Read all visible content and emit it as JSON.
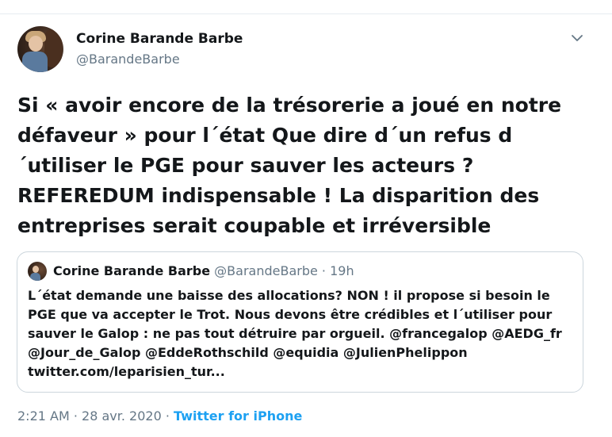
{
  "author": {
    "name": "Corine Barande Barbe",
    "handle": "@BarandeBarbe"
  },
  "tweet": {
    "text": "Si « avoir encore de la trésorerie a joué en notre défaveur » pour l´état Que dire d´un refus d´utiliser le PGE pour sauver les acteurs ? REFEREDUM indispensable ! La disparition des entreprises serait coupable et irréversible"
  },
  "quoted_tweet": {
    "name": "Corine Barande Barbe",
    "handle": "@BarandeBarbe",
    "separator": "·",
    "time": "19h",
    "text": "L´état demande une baisse des allocations?  NON ! il propose si besoin le PGE que va accepter le Trot. Nous devons être crédibles et l´utiliser pour sauver le Galop : ne pas tout détruire par orgueil. @francegalop @AEDG_fr @Jour_de_Galop @EddeRothschild @equidia @JulienPhelippon twitter.com/leparisien_tur..."
  },
  "meta": {
    "time": "2:21 AM",
    "date": "28 avr. 2020",
    "separator": "·",
    "source": "Twitter for iPhone"
  },
  "icons": {
    "menu": "chevron-down-icon"
  },
  "colors": {
    "text": "#14171a",
    "secondary": "#657786",
    "link": "#1da1f2",
    "border": "#ccd6dd"
  }
}
